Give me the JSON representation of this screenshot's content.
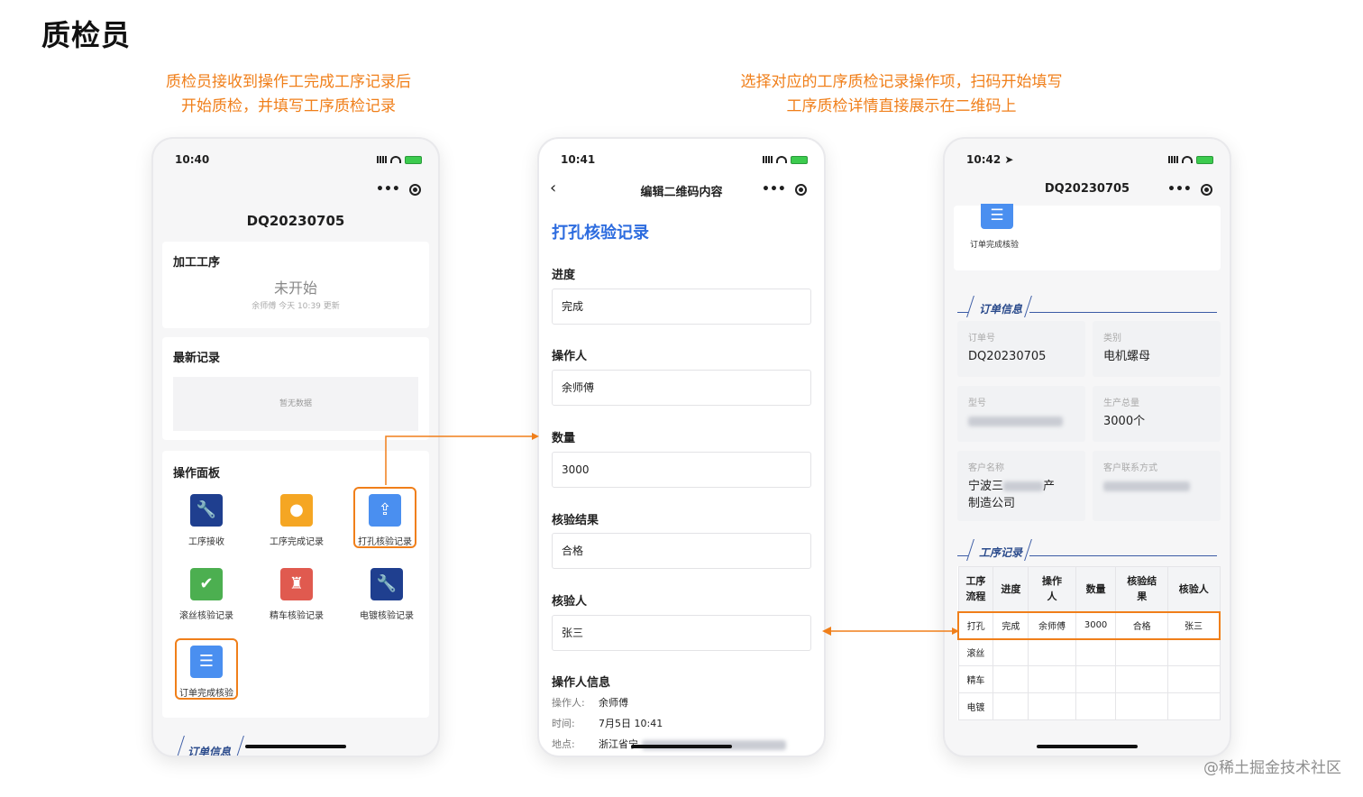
{
  "heading": "质检员",
  "caption_left": [
    "质检员接收到操作工完成工序记录后",
    "开始质检，并填写工序质检记录"
  ],
  "caption_right": [
    "选择对应的工序质检记录操作项，扫码开始填写",
    "工序质检详情直接展示在二维码上"
  ],
  "watermark": "@稀土掘金技术社区",
  "phone1": {
    "time": "10:40",
    "title": "DQ20230705",
    "process_card": {
      "title": "加工工序",
      "status": "未开始",
      "meta": "余师傅 今天 10:39 更新"
    },
    "latest_card": {
      "title": "最新记录",
      "empty": "暂无数据"
    },
    "panel": {
      "title": "操作面板",
      "tiles": [
        {
          "label": "工序接收",
          "icon": "wrench-icon",
          "color": "#1f3f8f",
          "glyph": "🔧"
        },
        {
          "label": "工序完成记录",
          "icon": "location-pin-icon",
          "color": "#f5a623",
          "glyph": "●"
        },
        {
          "label": "打孔核验记录",
          "icon": "upload-box-icon",
          "color": "#4a8ff0",
          "glyph": "⇪"
        },
        {
          "label": "滚丝核验记录",
          "icon": "shield-check-icon",
          "color": "#4caf50",
          "glyph": "✔"
        },
        {
          "label": "精车核验记录",
          "icon": "hydrant-icon",
          "color": "#e05a4f",
          "glyph": "♜"
        },
        {
          "label": "电镀核验记录",
          "icon": "wrench-icon",
          "color": "#1f3f8f",
          "glyph": "🔧"
        },
        {
          "label": "订单完成核验",
          "icon": "list-icon",
          "color": "#4a8ff0",
          "glyph": "☰"
        }
      ]
    },
    "bottom_tab": "订单信息"
  },
  "phone2": {
    "time": "10:41",
    "nav_title": "编辑二维码内容",
    "form_title": "打孔核验记录",
    "fields": [
      {
        "label": "进度",
        "value": "完成"
      },
      {
        "label": "操作人",
        "value": "余师傅"
      },
      {
        "label": "数量",
        "value": "3000"
      },
      {
        "label": "核验结果",
        "value": "合格"
      },
      {
        "label": "核验人",
        "value": "张三"
      }
    ],
    "operator_section": "操作人信息",
    "operator_rows": [
      {
        "key": "操作人:",
        "value": "余师傅"
      },
      {
        "key": "时间:",
        "value": "7月5日 10:41"
      },
      {
        "key": "地点:",
        "value": "浙江省宁"
      }
    ]
  },
  "phone3": {
    "time": "10:42",
    "title": "DQ20230705",
    "top_tile_label": "订单完成核验",
    "order_section": "订单信息",
    "info": [
      {
        "label": "订单号",
        "value": "DQ20230705"
      },
      {
        "label": "类别",
        "value": "电机螺母"
      },
      {
        "label": "型号",
        "value": ""
      },
      {
        "label": "生产总量",
        "value": "3000个"
      },
      {
        "label": "客户名称",
        "value": "宁波三",
        "value_tail": "产",
        "value2": "制造公司"
      },
      {
        "label": "客户联系方式",
        "value": ""
      }
    ],
    "process_section": "工序记录",
    "table_headers": [
      [
        "工序",
        "流程"
      ],
      [
        "进度"
      ],
      [
        "操作",
        "人"
      ],
      [
        "数量"
      ],
      [
        "核验结",
        "果"
      ],
      [
        "核验人"
      ]
    ],
    "table_rows": [
      [
        "打孔",
        "完成",
        "余师傅",
        "3000",
        "合格",
        "张三"
      ],
      [
        "滚丝",
        "",
        "",
        "",
        "",
        ""
      ],
      [
        "精车",
        "",
        "",
        "",
        "",
        ""
      ],
      [
        "电镀",
        "",
        "",
        "",
        "",
        ""
      ]
    ]
  },
  "colors": {
    "accent": "#f07f1a",
    "primary": "#2d6cdf",
    "brand_dark": "#1f3f8f"
  }
}
